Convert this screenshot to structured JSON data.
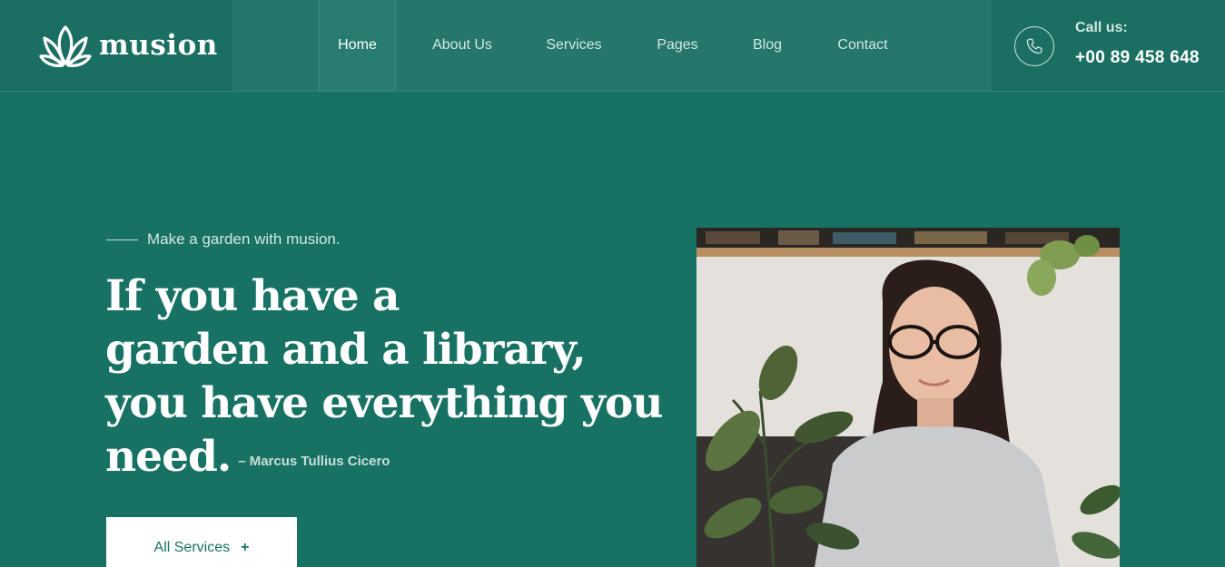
{
  "brand": {
    "name": "musion",
    "icon": "lotus-icon"
  },
  "nav": {
    "items": [
      {
        "label": "Home",
        "active": true
      },
      {
        "label": "About Us",
        "active": false
      },
      {
        "label": "Services",
        "active": false
      },
      {
        "label": "Pages",
        "active": false
      },
      {
        "label": "Blog",
        "active": false
      },
      {
        "label": "Contact",
        "active": false
      }
    ]
  },
  "call": {
    "label": "Call us:",
    "number": "+00 89 458 648",
    "icon": "phone-icon"
  },
  "hero": {
    "tagline": "Make a garden with musion.",
    "headline_lines": [
      "If you have a",
      "garden and a library,",
      "you have everything you",
      "need."
    ],
    "author": "– Marcus Tullius Cicero",
    "cta_label": "All Services",
    "cta_icon": "+",
    "image": "woman-with-plant-photo"
  },
  "colors": {
    "background": "#187264",
    "header": "#24776a",
    "accent_dark": "#1b6f62",
    "text_light": "#d3e6e2",
    "white": "#ffffff"
  }
}
